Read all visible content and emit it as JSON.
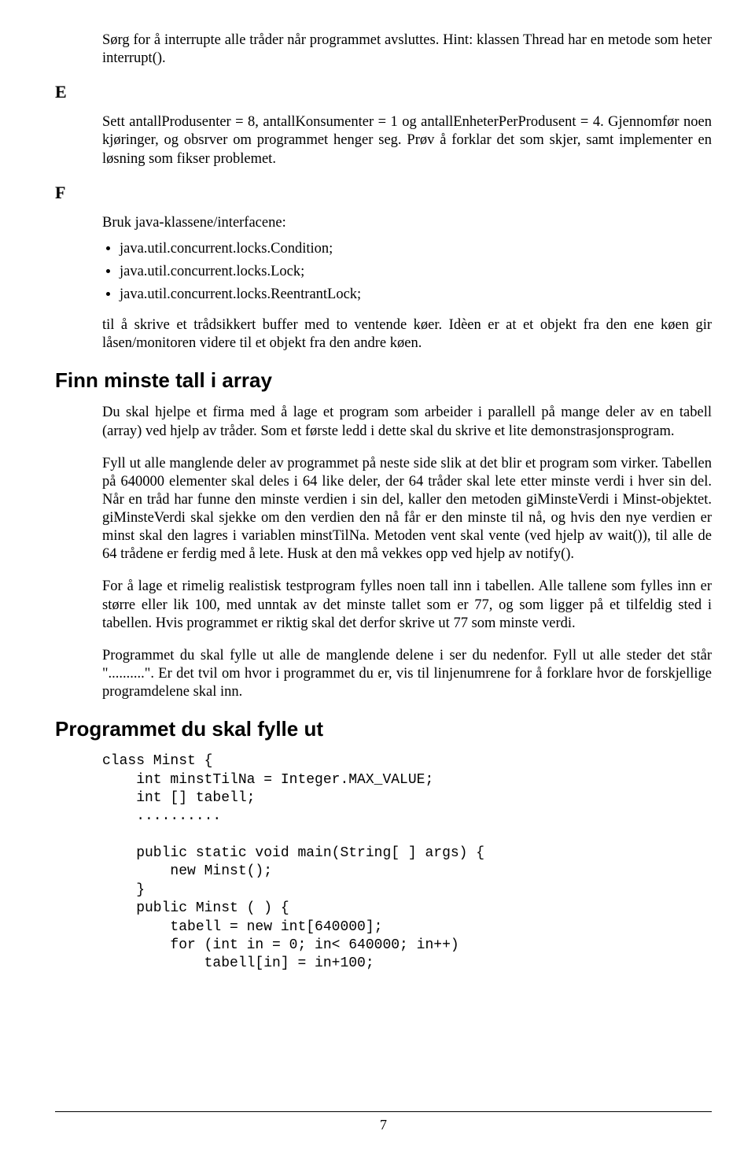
{
  "para_intro": "Sørg for å interrupte alle tråder når programmet avsluttes. Hint: klassen Thread har en metode som heter interrupt().",
  "letter_E": "E",
  "para_E": "Sett antallProdusenter = 8, antallKonsumenter = 1 og antallEnheterPerProdusent = 4. Gjennomfør noen kjøringer, og obsrver om programmet henger seg. Prøv å forklar det som skjer, samt implementer en løsning som fikser problemet.",
  "letter_F": "F",
  "para_F_intro": "Bruk java-klassene/interfacene:",
  "bullets": [
    "java.util.concurrent.locks.Condition;",
    "java.util.concurrent.locks.Lock;",
    "java.util.concurrent.locks.ReentrantLock;"
  ],
  "para_F_after": "til å skrive et trådsikkert buffer med to ventende køer. Idèen er at et objekt fra den ene køen gir låsen/monitoren videre til et objekt fra den andre køen.",
  "h2_finn": "Finn minste tall i array",
  "para_finn_1": "Du skal hjelpe et firma med å lage et program som arbeider i parallell på mange deler av en tabell (array) ved hjelp av tråder. Som et første ledd i dette skal du skrive et lite demonstrasjonsprogram.",
  "para_finn_2": "Fyll ut alle manglende deler av programmet på neste side slik at det blir et program som virker. Tabellen på 640000 elementer skal deles i 64 like deler, der 64 tråder skal lete etter minste verdi i hver sin del. Når en tråd har funne den minste verdien i sin del, kaller den metoden giMinsteVerdi i Minst-objektet. giMinsteVerdi skal sjekke om den verdien den nå får er den minste til nå, og hvis den nye verdien er minst skal den lagres i variablen minstTilNa. Metoden vent skal vente (ved hjelp av wait()), til alle de 64 trådene er ferdig med å lete. Husk at den må vekkes opp ved hjelp av notify().",
  "para_finn_3": "For å lage et rimelig realistisk testprogram fylles noen tall inn i tabellen. Alle tallene som fylles inn er større eller lik 100, med unntak av det minste tallet som er 77, og som ligger på et tilfeldig sted i tabellen. Hvis programmet er riktig skal det derfor skrive ut 77 som minste verdi.",
  "para_finn_4": "Programmet du skal fylle ut alle de manglende delene i ser du nedenfor. Fyll ut alle steder det står \"..........\". Er det tvil om hvor i programmet du er, vis til linjenumrene for å forklare hvor de forskjellige programdelene skal inn.",
  "h2_prog": "Programmet du skal fylle ut",
  "code": "class Minst {\n    int minstTilNa = Integer.MAX_VALUE;\n    int [] tabell;\n    ..........\n\n    public static void main(String[ ] args) {\n        new Minst();\n    }\n    public Minst ( ) {\n        tabell = new int[640000];\n        for (int in = 0; in< 640000; in++)\n            tabell[in] = in+100;",
  "page_number": "7"
}
